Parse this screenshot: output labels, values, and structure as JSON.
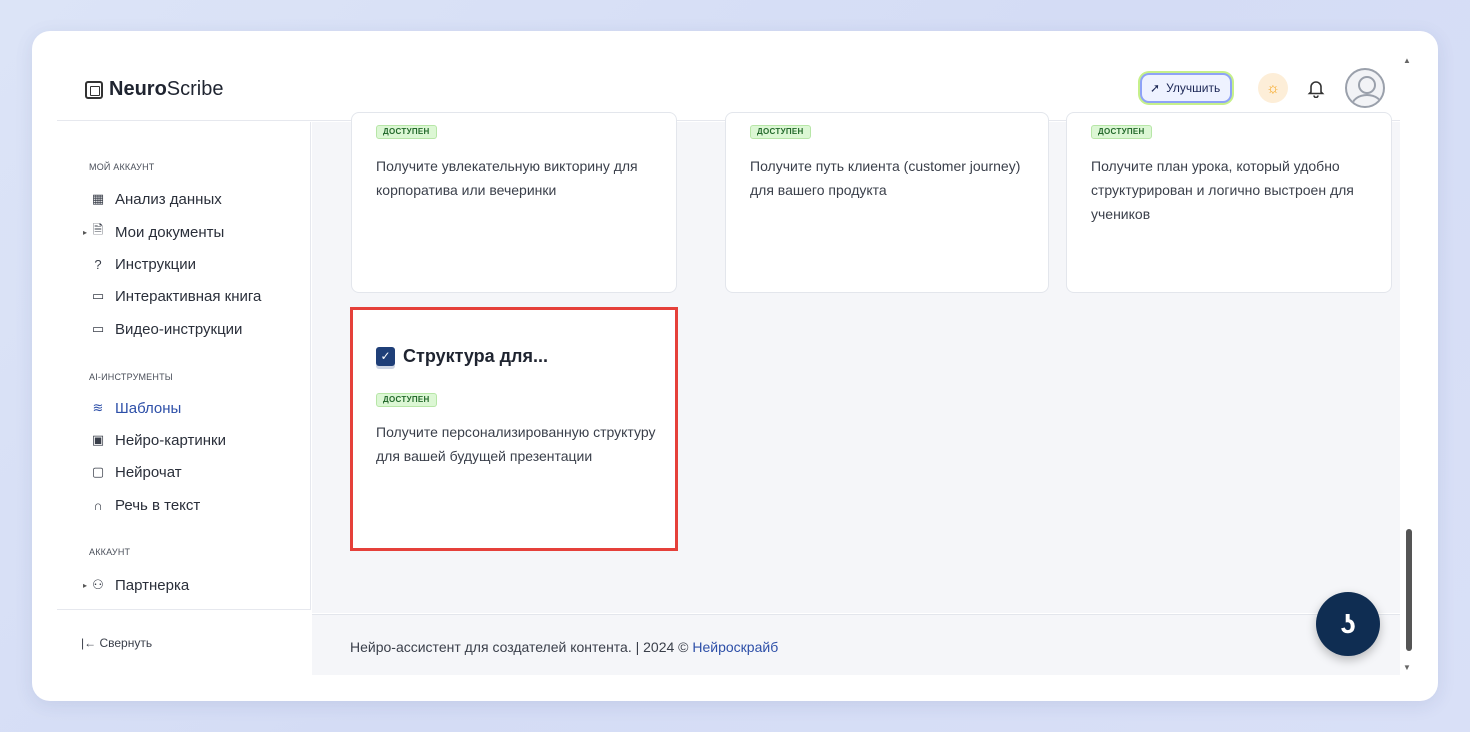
{
  "header": {
    "logo_bold": "Neuro",
    "logo_rest": "Scribe",
    "upgrade_label": "Улучшить"
  },
  "sidebar": {
    "section_account": "МОЙ АККАУНТ",
    "items_account": [
      {
        "label": "Анализ данных",
        "icon": "grid-icon"
      },
      {
        "label": "Мои документы",
        "icon": "document-icon"
      },
      {
        "label": "Инструкции",
        "icon": "help-circle-icon"
      },
      {
        "label": "Интерактивная книга",
        "icon": "book-icon"
      },
      {
        "label": "Видео-инструкции",
        "icon": "video-icon"
      }
    ],
    "section_ai": "AI-ИНСТРУМЕНТЫ",
    "items_ai": [
      {
        "label": "Шаблоны",
        "icon": "layers-icon"
      },
      {
        "label": "Нейро-картинки",
        "icon": "image-icon"
      },
      {
        "label": "Нейрочат",
        "icon": "chat-icon"
      },
      {
        "label": "Речь в текст",
        "icon": "headphones-icon"
      }
    ],
    "section_acc2": "АККАУНТ",
    "items_acc2": [
      {
        "label": "Партнерка",
        "icon": "users-icon"
      }
    ],
    "collapse_label": "|← Свернуть"
  },
  "cards": [
    {
      "badge": "ДОСТУПЕН",
      "desc": "Получите увлекательную викторину для корпоратива или вечеринки"
    },
    {
      "badge": "ДОСТУПЕН",
      "desc": "Получите путь клиента (customer journey) для вашего продукта"
    },
    {
      "badge": "ДОСТУПЕН",
      "desc": "Получите план урока, который удобно структурирован и логично выстроен для учеников"
    },
    {
      "title": "Структура для...",
      "badge": "ДОСТУПЕН",
      "desc": "Получите персонализированную структуру для вашей будущей презентации"
    }
  ],
  "footer": {
    "text": "Нейро-ассистент для создателей контента.  | 2024 © ",
    "link": "Нейроскрайб"
  },
  "colors": {
    "accent": "#2d4fa8",
    "badge_bg": "#dcf7d4",
    "highlight": "#e5403a",
    "fab": "#0f2d52"
  }
}
